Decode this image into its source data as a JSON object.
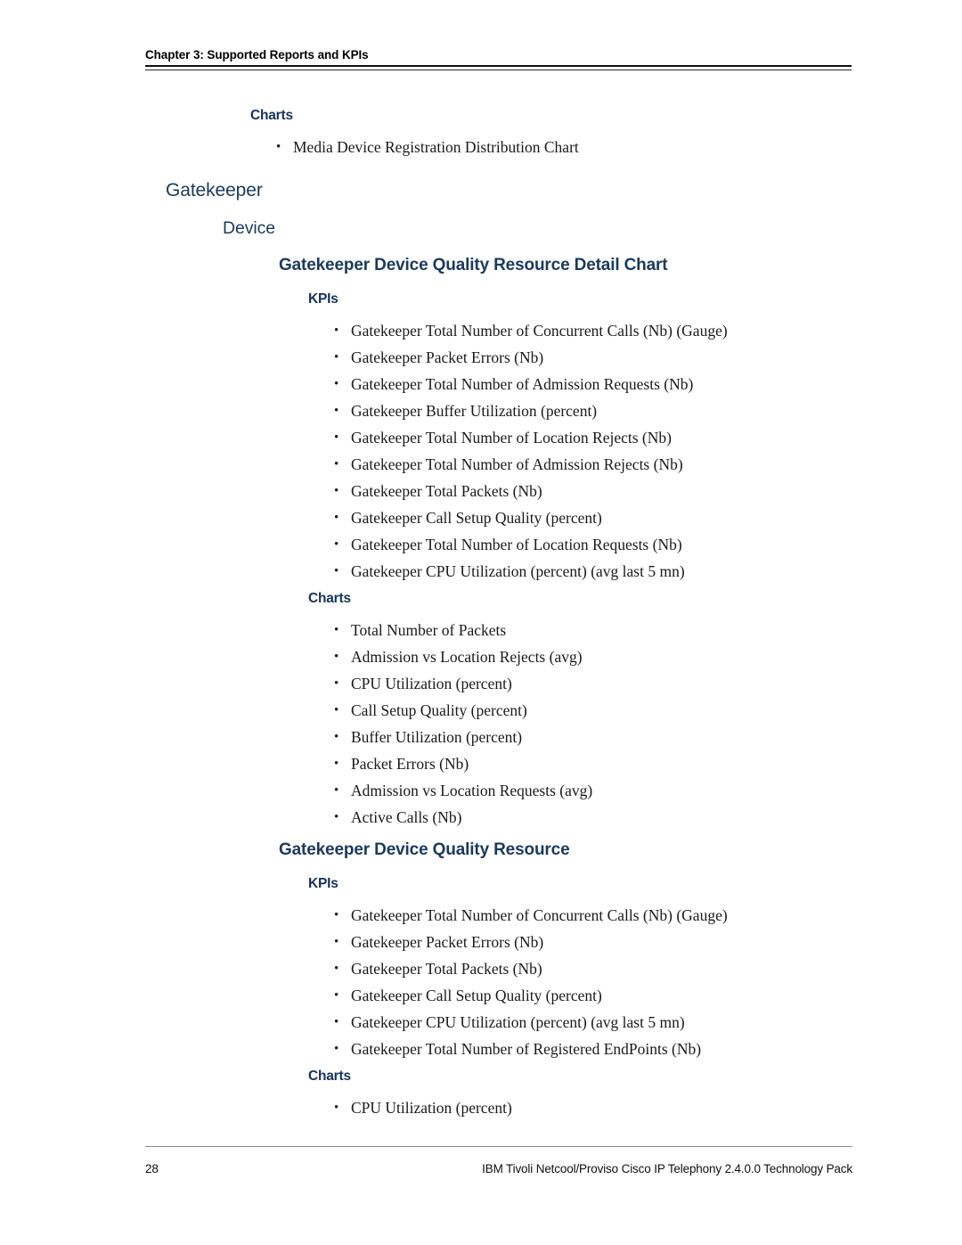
{
  "running_head": {
    "text": "Chapter 3:  Supported Reports and KPIs"
  },
  "intro": {
    "charts_label": "Charts",
    "charts_items": [
      "Media Device Registration Distribution Chart"
    ]
  },
  "headings": {
    "level1": "Gatekeeper",
    "level2": "Device"
  },
  "sections": [
    {
      "title": "Gatekeeper Device Quality Resource Detail Chart",
      "kpis_label": "KPIs",
      "kpis": [
        "Gatekeeper Total Number of Concurrent Calls (Nb) (Gauge)",
        "Gatekeeper Packet Errors (Nb)",
        "Gatekeeper Total Number of Admission Requests (Nb)",
        "Gatekeeper Buffer Utilization (percent)",
        "Gatekeeper Total Number of Location Rejects (Nb)",
        "Gatekeeper Total Number of Admission Rejects (Nb)",
        "Gatekeeper Total Packets (Nb)",
        "Gatekeeper Call Setup Quality (percent)",
        "Gatekeeper Total Number of Location Requests (Nb)",
        "Gatekeeper CPU Utilization (percent) (avg last 5 mn)"
      ],
      "charts_label": "Charts",
      "charts": [
        "Total Number of Packets",
        "Admission vs Location Rejects (avg)",
        "CPU Utilization (percent)",
        "Call Setup Quality (percent)",
        "Buffer Utilization (percent)",
        "Packet Errors (Nb)",
        "Admission vs Location Requests (avg)",
        "Active Calls (Nb)"
      ]
    },
    {
      "title": "Gatekeeper Device Quality Resource",
      "kpis_label": "KPIs",
      "kpis": [
        "Gatekeeper Total Number of Concurrent Calls (Nb) (Gauge)",
        "Gatekeeper Packet Errors (Nb)",
        "Gatekeeper Total Packets (Nb)",
        "Gatekeeper Call Setup Quality (percent)",
        "Gatekeeper CPU Utilization (percent) (avg last 5 mn)",
        "Gatekeeper Total Number of Registered EndPoints (Nb)"
      ],
      "charts_label": "Charts",
      "charts": [
        "CPU Utilization (percent)"
      ]
    }
  ],
  "footer": {
    "page_number": "28",
    "publication": "IBM Tivoli Netcool/Proviso Cisco IP Telephony 2.4.0.0 Technology Pack"
  },
  "bullet_glyph": "•",
  "colors": {
    "heading": "#1b3a5c",
    "label": "#16325a",
    "body": "#1a1a1a",
    "rule": "#8a8a8a"
  }
}
